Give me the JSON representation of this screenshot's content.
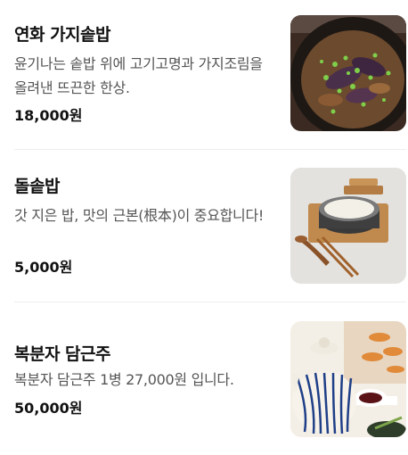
{
  "menu": {
    "items": [
      {
        "name": "연화 가지솥밥",
        "description": "윤기나는 솥밥 위에 고기고명과 가지조림을 올려낸 뜨끈한 한상.",
        "price": "18,000원",
        "photo_icon": "eggplant-rice-photo"
      },
      {
        "name": "돌솥밥",
        "description": "갓 지은 밥, 맛의 근본(根本)이 중요합니다!",
        "price": "5,000원",
        "photo_icon": "stone-pot-rice-photo"
      },
      {
        "name": "복분자 담근주",
        "description": "복분자 담근주 1병 27,000원 입니다.",
        "price": "50,000원",
        "photo_icon": "bokbunja-liquor-photo"
      }
    ]
  }
}
